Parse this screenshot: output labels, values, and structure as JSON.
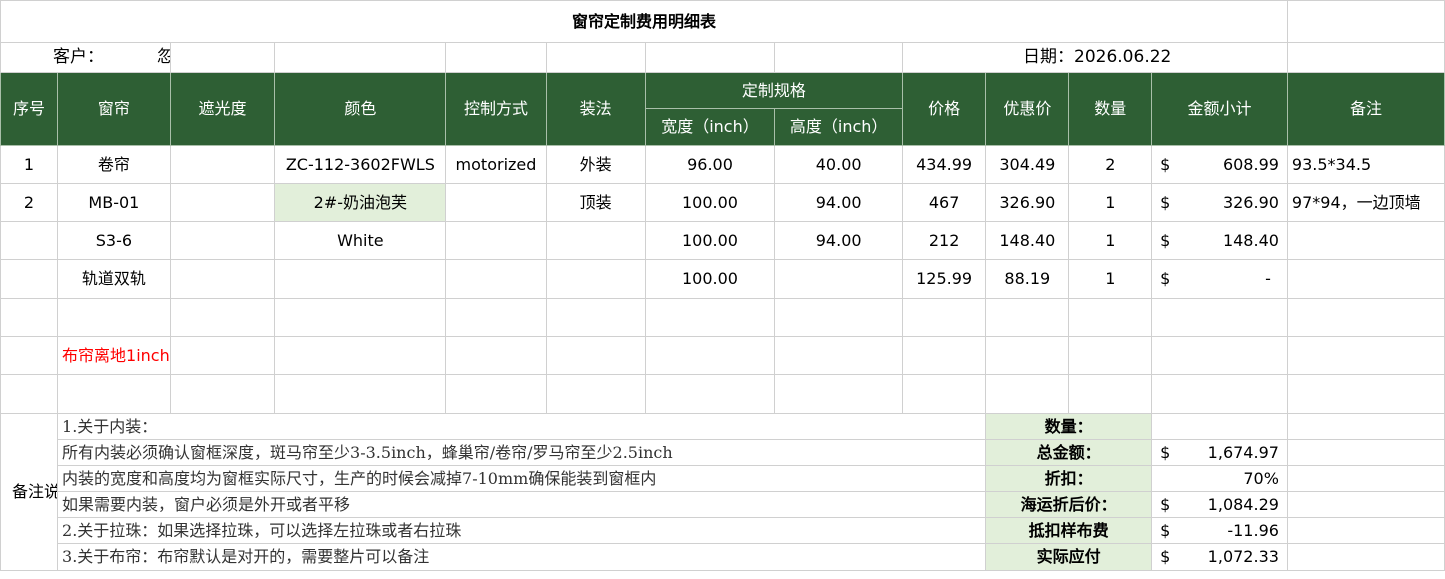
{
  "title": "窗帘定制费用明细表",
  "customer": {
    "label": "客户：",
    "name": "忽忽"
  },
  "date": {
    "label": "日期：2026.06.22"
  },
  "headers": {
    "seq": "序号",
    "curtain": "窗帘",
    "shading": "遮光度",
    "color": "颜色",
    "control": "控制方式",
    "install": "装法",
    "spec": "定制规格",
    "width": "宽度（inch）",
    "height": "高度（inch）",
    "price": "价格",
    "discount_price": "优惠价",
    "qty": "数量",
    "subtotal": "金额小计",
    "remark": "备注"
  },
  "rows": [
    {
      "seq": "1",
      "curtain": "卷帘",
      "shading": "",
      "color": "ZC-112-3602FWLS",
      "control": "motorized",
      "install": "外装",
      "width": "96.00",
      "height": "40.00",
      "price": "434.99",
      "discount_price": "304.49",
      "qty": "2",
      "currency": "$",
      "subtotal": "608.99",
      "remark": "93.5*34.5"
    },
    {
      "seq": "2",
      "curtain": "MB-01",
      "shading": "",
      "color": "2#-奶油泡芙",
      "control": "",
      "install": "顶装",
      "width": "100.00",
      "height": "94.00",
      "price": "467",
      "discount_price": "326.90",
      "qty": "1",
      "currency": "$",
      "subtotal": "326.90",
      "remark": "97*94，一边顶墙"
    },
    {
      "seq": "",
      "curtain": "S3-6",
      "shading": "",
      "color": "White",
      "control": "",
      "install": "",
      "width": "100.00",
      "height": "94.00",
      "price": "212",
      "discount_price": "148.40",
      "qty": "1",
      "currency": "$",
      "subtotal": "148.40",
      "remark": ""
    },
    {
      "seq": "",
      "curtain": "轨道双轨",
      "shading": "",
      "color": "",
      "control": "",
      "install": "",
      "width": "100.00",
      "height": "",
      "price": "125.99",
      "discount_price": "88.19",
      "qty": "1",
      "currency": "$",
      "subtotal": "-",
      "remark": ""
    }
  ],
  "red_note": "布帘离地1inch",
  "remarks_label": "备注说明",
  "notes": [
    "1.关于内装：",
    "所有内装必须确认窗框深度，斑马帘至少3-3.5inch，蜂巢帘/卷帘/罗马帘至少2.5inch",
    "内装的宽度和高度均为窗框实际尺寸，生产的时候会减掉7-10mm确保能装到窗框内",
    "如果需要内装，窗户必须是外开或者平移",
    "2.关于拉珠：如果选择拉珠，可以选择左拉珠或者右拉珠",
    "3.关于布帘：布帘默认是对开的，需要整片可以备注"
  ],
  "summary": [
    {
      "label": "数量：",
      "currency": "",
      "value": ""
    },
    {
      "label": "总金额：",
      "currency": "$",
      "value": "1,674.97"
    },
    {
      "label": "折扣：",
      "currency": "",
      "value": "70%"
    },
    {
      "label": "海运折后价：",
      "currency": "$",
      "value": "1,084.29"
    },
    {
      "label": "抵扣样布费",
      "currency": "$",
      "value": "-11.96"
    },
    {
      "label": "实际应付",
      "currency": "$",
      "value": "1,072.33"
    }
  ],
  "colors": {
    "header_bg": "#2e5f34",
    "highlight_bg": "#e2efda",
    "note_red": "#ff0000"
  }
}
